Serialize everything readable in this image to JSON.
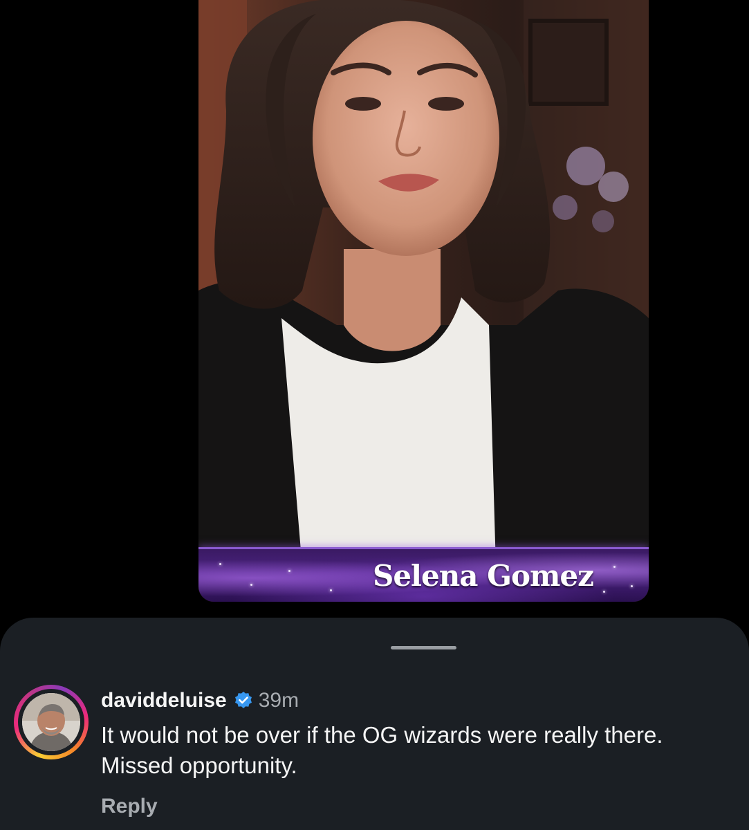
{
  "video": {
    "name_caption": "Selena Gomez",
    "accent_color": "#4b2380"
  },
  "comments_sheet": {
    "handle_color": "#9a9ea3",
    "background_color": "#1b1f24",
    "comment": {
      "avatar_icon": "user-avatar-photo",
      "username": "daviddeluise",
      "verified_icon": "verified-badge-icon",
      "verified_color": "#3797f0",
      "time": "39m",
      "text": "It would not be over if the OG wizards were really there. Missed opportunity.",
      "reply_label": "Reply"
    }
  }
}
